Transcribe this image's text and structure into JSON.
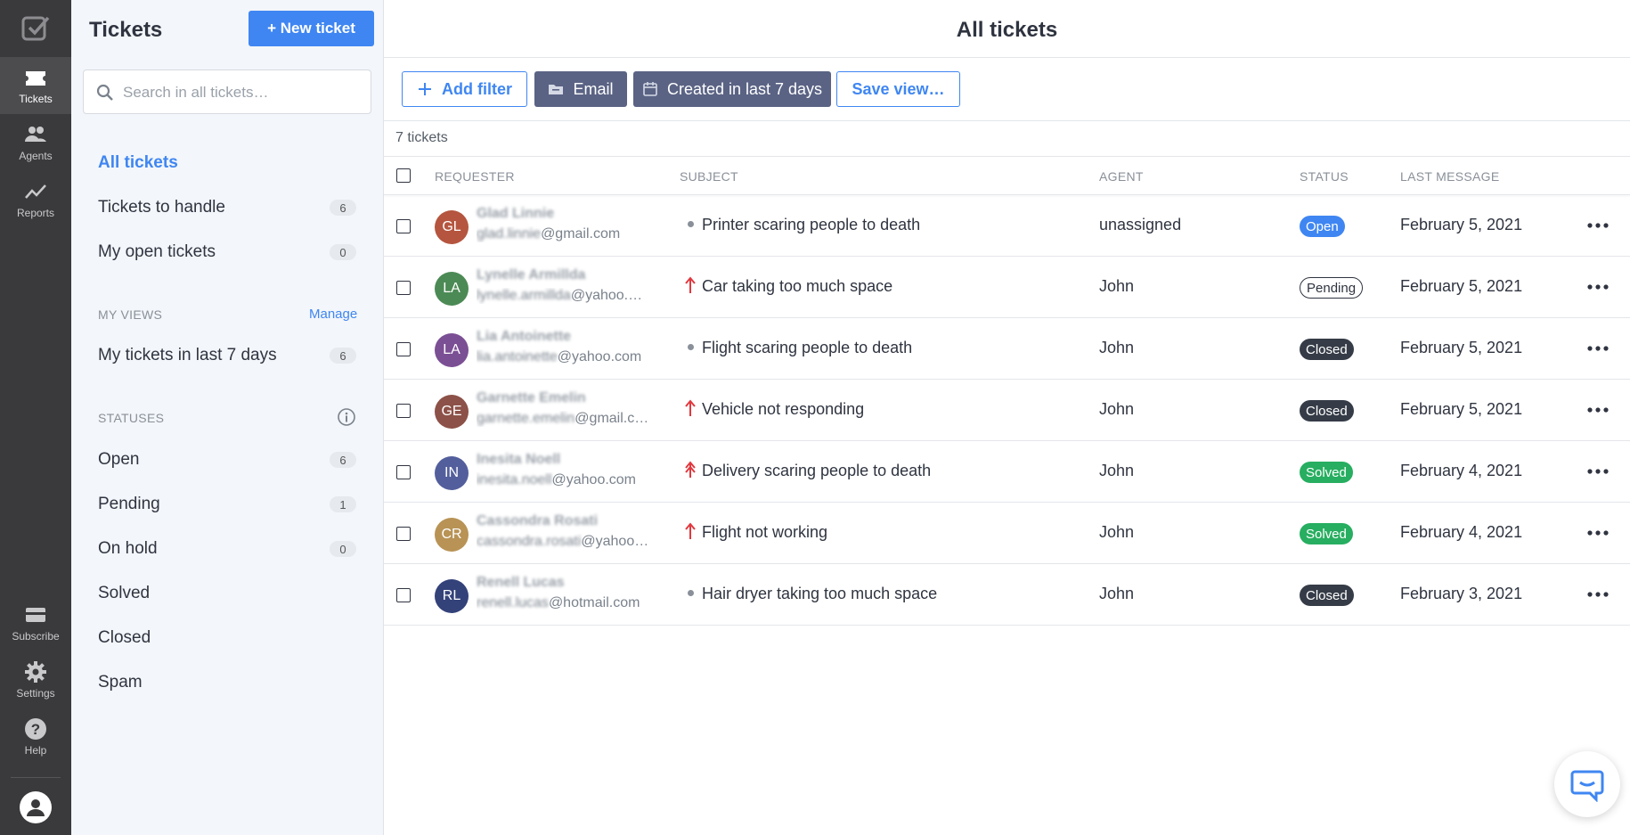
{
  "rail": {
    "items": [
      {
        "label": "Tickets",
        "icon": "tickets-icon",
        "active": true
      },
      {
        "label": "Agents",
        "icon": "agents-icon"
      },
      {
        "label": "Reports",
        "icon": "reports-icon"
      }
    ],
    "bottom": [
      {
        "label": "Subscribe",
        "icon": "card-icon"
      },
      {
        "label": "Settings",
        "icon": "gear-icon"
      },
      {
        "label": "Help",
        "icon": "help-icon"
      }
    ]
  },
  "sidebar": {
    "title": "Tickets",
    "new_ticket_label": "+ New ticket",
    "search_placeholder": "Search in all tickets…",
    "nav": [
      {
        "label": "All tickets",
        "count": null
      },
      {
        "label": "Tickets to handle",
        "count": "6"
      },
      {
        "label": "My open tickets",
        "count": "0"
      }
    ],
    "views_label": "MY VIEWS",
    "manage_label": "Manage",
    "views": [
      {
        "label": "My tickets in last 7 days",
        "count": "6"
      }
    ],
    "statuses_label": "STATUSES",
    "statuses": [
      {
        "label": "Open",
        "count": "6"
      },
      {
        "label": "Pending",
        "count": "1"
      },
      {
        "label": "On hold",
        "count": "0"
      },
      {
        "label": "Solved",
        "count": null
      },
      {
        "label": "Closed",
        "count": null
      },
      {
        "label": "Spam",
        "count": null
      }
    ]
  },
  "main": {
    "title": "All tickets",
    "toolbar": {
      "add_filter": "Add filter",
      "email": "Email",
      "created": "Created in last 7 days",
      "save_view": "Save view…"
    },
    "ticket_count": "7 tickets",
    "columns": {
      "requester": "REQUESTER",
      "subject": "SUBJECT",
      "agent": "AGENT",
      "status": "STATUS",
      "last_message": "LAST MESSAGE"
    },
    "rows": [
      {
        "initials": "GL",
        "avatar_color": "#b5553f",
        "name": "Glad Linnie",
        "email_user": "glad.linnie",
        "email_domain": "@gmail.com",
        "priority": "normal",
        "subject": "Printer scaring people to death",
        "agent": "unassigned",
        "status": "Open",
        "date": "February 5, 2021"
      },
      {
        "initials": "LA",
        "avatar_color": "#4c8a55",
        "name": "Lynelle Armillda",
        "email_user": "lynelle.armillda",
        "email_domain": "@yahoo.…",
        "priority": "high",
        "subject": "Car taking too much space",
        "agent": "John",
        "status": "Pending",
        "date": "February 5, 2021"
      },
      {
        "initials": "LA",
        "avatar_color": "#7b4f94",
        "name": "Lia Antoinette",
        "email_user": "lia.antoinette",
        "email_domain": "@yahoo.com",
        "priority": "normal",
        "subject": "Flight scaring people to death",
        "agent": "John",
        "status": "Closed",
        "date": "February 5, 2021"
      },
      {
        "initials": "GE",
        "avatar_color": "#8c5148",
        "name": "Garnette Emelin",
        "email_user": "garnette.emelin",
        "email_domain": "@gmail.c…",
        "priority": "high",
        "subject": "Vehicle not responding",
        "agent": "John",
        "status": "Closed",
        "date": "February 5, 2021"
      },
      {
        "initials": "IN",
        "avatar_color": "#535f9c",
        "name": "Inesita Noell",
        "email_user": "inesita.noell",
        "email_domain": "@yahoo.com",
        "priority": "urgent",
        "subject": "Delivery scaring people to death",
        "agent": "John",
        "status": "Solved",
        "date": "February 4, 2021"
      },
      {
        "initials": "CR",
        "avatar_color": "#b89355",
        "name": "Cassondra Rosati",
        "email_user": "cassondra.rosati",
        "email_domain": "@yahoo…",
        "priority": "high",
        "subject": "Flight not working",
        "agent": "John",
        "status": "Solved",
        "date": "February 4, 2021"
      },
      {
        "initials": "RL",
        "avatar_color": "#34427a",
        "name": "Renell Lucas",
        "email_user": "renell.lucas",
        "email_domain": "@hotmail.com",
        "priority": "normal",
        "subject": "Hair dryer taking too much space",
        "agent": "John",
        "status": "Closed",
        "date": "February 3, 2021"
      }
    ]
  },
  "colors": {
    "accent": "#3f86f2",
    "rail_bg": "#3a3a3c",
    "sidebar_bg": "#f3f6fa",
    "priority_high": "#e0383e",
    "status_open": "#3f86f2",
    "status_closed": "#353c47",
    "status_solved": "#27ae60"
  }
}
